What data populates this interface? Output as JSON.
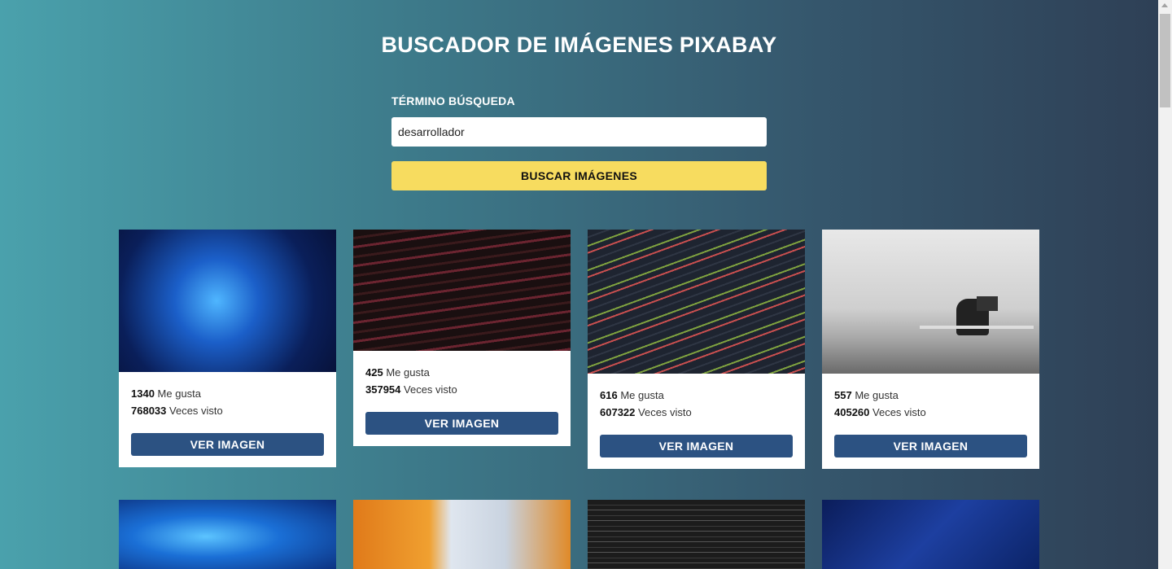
{
  "app": {
    "title": "BUSCADOR DE IMÁGENES PIXABAY"
  },
  "search": {
    "label": "TÉRMINO BÚSQUEDA",
    "value": "desarrollador",
    "button_label": "BUSCAR IMÁGENES"
  },
  "cards": [
    {
      "likes": "1340",
      "likes_label": "Me gusta",
      "views": "768033",
      "views_label": "Veces visto",
      "button_label": "VER IMAGEN"
    },
    {
      "likes": "425",
      "likes_label": "Me gusta",
      "views": "357954",
      "views_label": "Veces visto",
      "button_label": "VER IMAGEN"
    },
    {
      "likes": "616",
      "likes_label": "Me gusta",
      "views": "607322",
      "views_label": "Veces visto",
      "button_label": "VER IMAGEN"
    },
    {
      "likes": "557",
      "likes_label": "Me gusta",
      "views": "405260",
      "views_label": "Veces visto",
      "button_label": "VER IMAGEN"
    }
  ],
  "colors": {
    "accent_button": "#f7dc5f",
    "card_button": "#2c5282"
  }
}
